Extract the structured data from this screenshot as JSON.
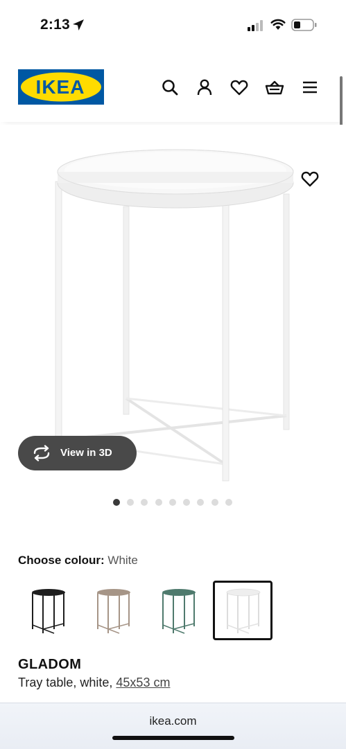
{
  "status_bar": {
    "time": "2:13"
  },
  "header": {
    "logo_text": "IKEA",
    "icons": [
      "search-icon",
      "account-icon",
      "heart-icon",
      "basket-icon",
      "menu-icon"
    ]
  },
  "product": {
    "view_3d_label": "View in 3D",
    "image_count": 9,
    "active_image": 1,
    "choose_colour_label": "Choose colour:",
    "selected_colour": "White",
    "swatches": [
      {
        "color": "#1e1e1e"
      },
      {
        "color": "#a69587"
      },
      {
        "color": "#4f7a6d"
      },
      {
        "color": "#f2f2f2"
      }
    ],
    "name": "GLADOM",
    "description": "Tray table, white,",
    "size": "45x53 cm"
  },
  "browser": {
    "url": "ikea.com"
  },
  "colors": {
    "ikea_blue": "#0058a3",
    "ikea_yellow": "#ffdb00"
  }
}
